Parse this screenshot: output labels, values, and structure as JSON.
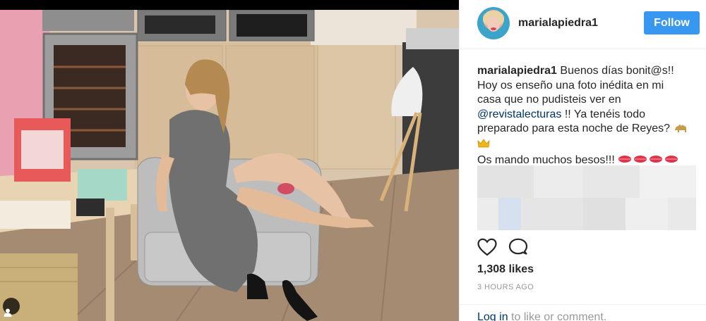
{
  "post": {
    "username": "marialapiedra1",
    "follow_label": "Follow",
    "caption": {
      "username": "marialapiedra1",
      "line1": "Buenos días bonit@s!!",
      "line2": "Hoy os enseño una foto inédita en mi",
      "line3": "casa que no pudisteis ver en",
      "mention": "@revistalecturas",
      "line4_rest": "!! Ya tenéis todo",
      "line5": "preparado para esta noche de Reyes?",
      "line7": "Os mando muchos besos!!!"
    },
    "likes": "1,308 likes",
    "timestamp": "3 HOURS AGO",
    "login_link": "Log in",
    "login_rest": "to like or comment."
  },
  "colors": {
    "follow_blue": "#3897f0",
    "mention_blue": "#003569",
    "text": "#262626",
    "muted": "#999999"
  },
  "icons": [
    "heart-icon",
    "comment-icon",
    "camel-emoji",
    "crown-emoji",
    "kiss-mark-emoji",
    "user-tag-icon"
  ]
}
